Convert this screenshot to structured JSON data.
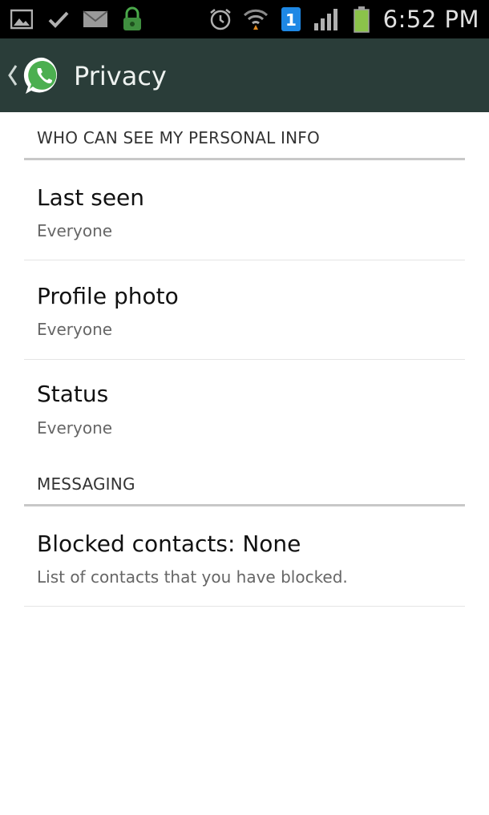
{
  "status_bar": {
    "time": "6:52 PM",
    "notification_badge": "1",
    "left_icons": [
      "gallery-icon",
      "check-icon",
      "mail-icon",
      "lock-icon"
    ],
    "right_icons": [
      "alarm-icon",
      "wifi-icon",
      "notification-badge-icon",
      "signal-icon",
      "battery-icon"
    ]
  },
  "action_bar": {
    "title": "Privacy",
    "back_icon": "chevron-left-icon",
    "logo_icon": "whatsapp-logo-icon",
    "background": "#2a3d39",
    "logo_color": "#4caf50"
  },
  "sections": {
    "personal_info": {
      "header": "WHO CAN SEE MY PERSONAL INFO",
      "items": [
        {
          "title": "Last seen",
          "summary": "Everyone"
        },
        {
          "title": "Profile photo",
          "summary": "Everyone"
        },
        {
          "title": "Status",
          "summary": "Everyone"
        }
      ]
    },
    "messaging": {
      "header": "MESSAGING",
      "items": [
        {
          "title": "Blocked contacts: None",
          "summary": "List of contacts that you have blocked."
        }
      ]
    }
  }
}
